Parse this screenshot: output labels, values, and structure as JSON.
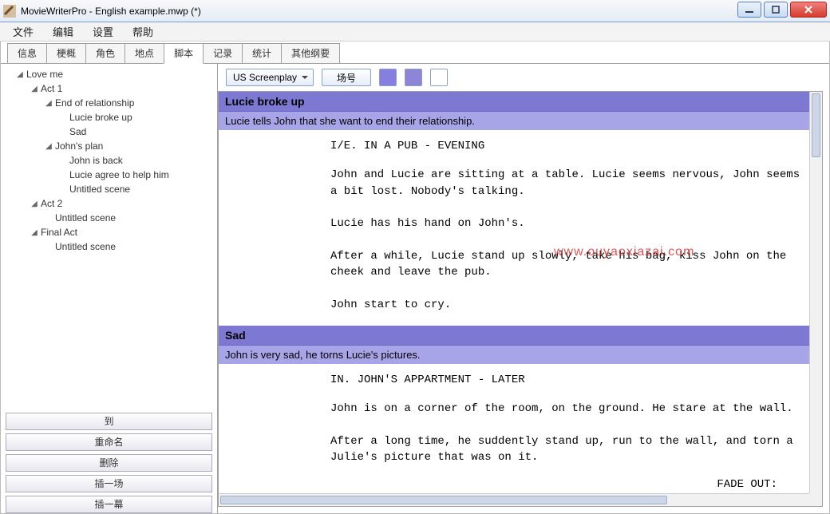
{
  "window": {
    "title": "MovieWriterPro - English example.mwp (*)"
  },
  "menu": {
    "items": [
      "文件",
      "编辑",
      "设置",
      "帮助"
    ]
  },
  "tabs": {
    "items": [
      "信息",
      "梗概",
      "角色",
      "地点",
      "脚本",
      "记录",
      "统计",
      "其他纲要"
    ],
    "activeIndex": 4
  },
  "tree": {
    "root": "Love me",
    "act1": "Act 1",
    "eor": "End of relationship",
    "lucie_broke": "Lucie broke up",
    "sad": "Sad",
    "johns_plan": "John's plan",
    "john_back": "John is back",
    "lucie_agree": "Lucie agree to help him",
    "untitled1": "Untitled scene",
    "act2": "Act 2",
    "untitled2": "Untitled scene",
    "final_act": "Final Act",
    "untitled3": "Untitled scene"
  },
  "sidebarButtons": {
    "goto": "到",
    "rename": "重命名",
    "delete": "删除",
    "insertScene": "插一场",
    "insertAct": "插一幕"
  },
  "toolbar": {
    "format": "US Screenplay",
    "sceneNumber": "场号"
  },
  "scenes": [
    {
      "title": "Lucie broke up",
      "desc": "Lucie tells John that she want to end their relationship.",
      "slug": "I/E. IN A PUB - EVENING",
      "body": "John and Lucie are sitting at a table. Lucie seems nervous, John seems a bit lost. Nobody's talking.\n\nLucie has his hand on John's.\n\nAfter a while, Lucie stand up slowly, take his bag, kiss John on the cheek and leave the pub.\n\nJohn start to cry."
    },
    {
      "title": "Sad",
      "desc": "John is very sad, he torns Lucie's pictures.",
      "slug": "IN. JOHN'S APPARTMENT - LATER",
      "body": "John is on a corner of the room, on the ground. He stare at the wall.\n\nAfter a long time, he suddently stand up, run to the wall, and torn a Julie's picture that was on it.",
      "fade": "FADE OUT:"
    }
  ],
  "watermark": "www.ouyaoxiazai.com"
}
